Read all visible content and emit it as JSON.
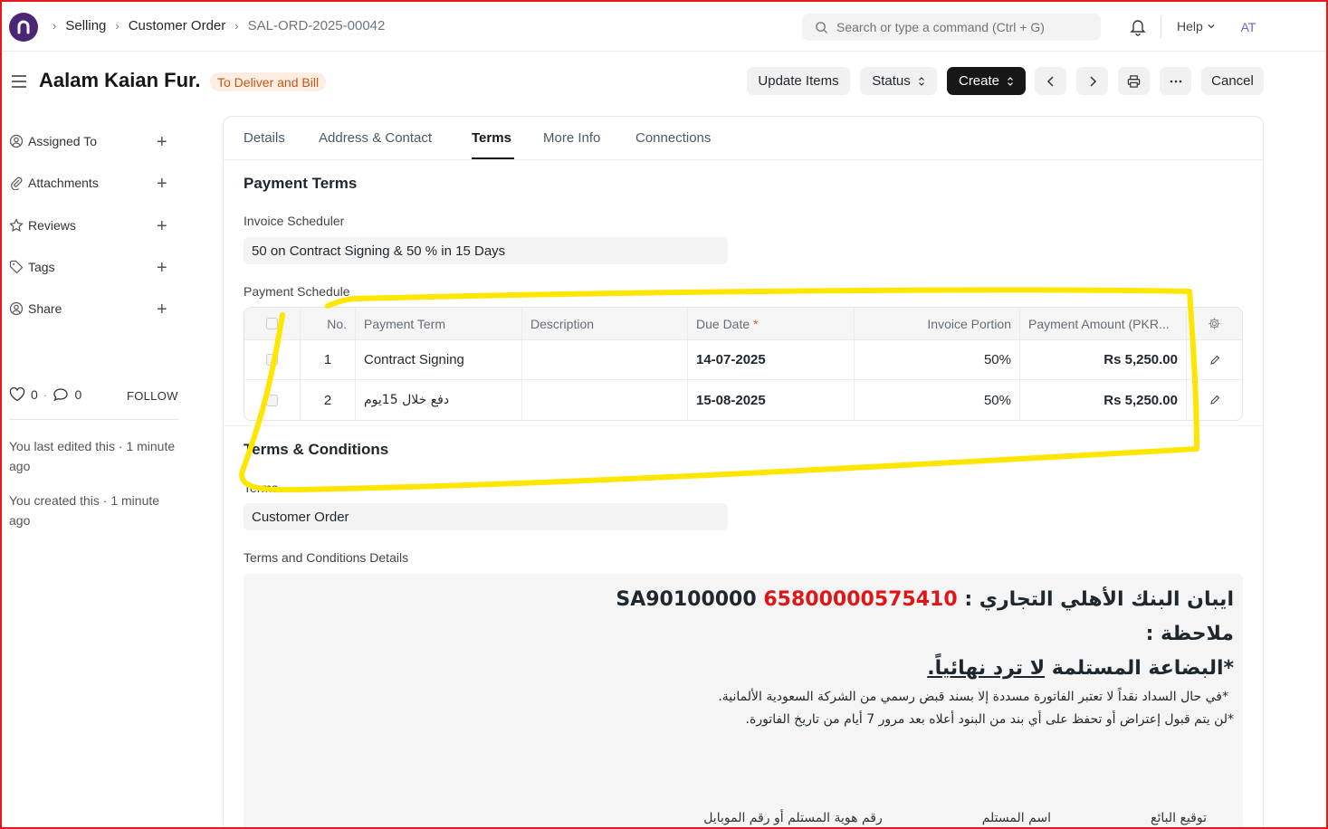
{
  "breadcrumbs": [
    "Selling",
    "Customer Order",
    "SAL-ORD-2025-00042"
  ],
  "search": {
    "placeholder": "Search or type a command (Ctrl + G)"
  },
  "help_label": "Help",
  "avatar_initials": "AT",
  "document": {
    "title": "Aalam Kaian Fur.",
    "status": "To Deliver and Bill"
  },
  "toolbar": {
    "update_items": "Update Items",
    "status": "Status",
    "create": "Create",
    "cancel": "Cancel"
  },
  "sidebar": {
    "items": [
      {
        "label": "Assigned To"
      },
      {
        "label": "Attachments"
      },
      {
        "label": "Reviews"
      },
      {
        "label": "Tags"
      },
      {
        "label": "Share"
      }
    ],
    "likes": "0",
    "comments": "0",
    "follow": "FOLLOW",
    "activity": [
      "You last edited this · 1 minute ago",
      "You created this · 1 minute ago"
    ]
  },
  "tabs": [
    "Details",
    "Address & Contact",
    "Terms",
    "More Info",
    "Connections"
  ],
  "payment_terms": {
    "section_title": "Payment Terms",
    "invoice_scheduler_label": "Invoice Scheduler",
    "invoice_scheduler_value": "50 on Contract Signing & 50 % in 15 Days",
    "schedule_label": "Payment Schedule"
  },
  "schedule": {
    "headers": [
      "No.",
      "Payment Term",
      "Description",
      "Due Date",
      "Invoice Portion",
      "Payment Amount (PKR..."
    ],
    "required_mark": "*",
    "rows": [
      {
        "no": "1",
        "term": "Contract Signing",
        "description": "",
        "due_date": "14-07-2025",
        "portion": "50%",
        "amount": "Rs 5,250.00"
      },
      {
        "no": "2",
        "term": "دفع خلال 15يوم",
        "description": "",
        "due_date": "15-08-2025",
        "portion": "50%",
        "amount": "Rs 5,250.00"
      }
    ]
  },
  "terms": {
    "section_title": "Terms & Conditions",
    "terms_label": "Terms",
    "terms_value": "Customer Order",
    "details_label": "Terms and Conditions Details"
  },
  "terms_body": {
    "iban_label": "ايبان البنك الأهلي التجاري :",
    "iban_red": "65800000575410",
    "iban_prefix": "SA90100000",
    "note": "ملاحظة :",
    "goods_prefix": "*البضاعة المستلمة ",
    "goods_underlined": "لا ترد نهائياً.",
    "line_cash": "*في حال السداد نقداً لا تعتبر الفاتورة مسددة إلا بسند قبض رسمي من الشركة السعودية الألمانية.",
    "line_objection": "*لن يتم قبول إعتراض أو تحفظ على أي بند من البنود أعلاه بعد مرور 7 أيام من تاريخ الفاتورة.",
    "sig_seller": "توقيع البائع",
    "sig_receiver_name": "اسم المستلم",
    "sig_receiver_id": "رقم هوية المستلم أو رقم الموبايل"
  },
  "colors": {
    "accent": "#171717",
    "status_bg": "#fdeee1",
    "status_fg": "#c0571f",
    "highlight": "#ffe600",
    "frame": "#e8161b",
    "iban_red": "#e01616"
  }
}
